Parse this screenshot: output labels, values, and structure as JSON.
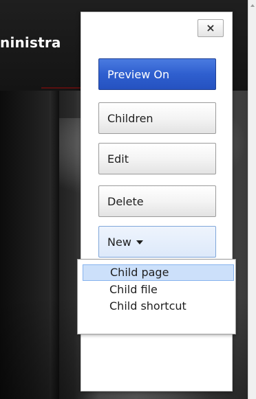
{
  "header": {
    "title_fragment": "ninistra"
  },
  "panel": {
    "close_label": "×",
    "buttons": {
      "preview": "Preview On",
      "children": "Children",
      "edit": "Edit",
      "delete": "Delete",
      "new": "New"
    }
  },
  "menu": {
    "items": [
      {
        "label": "Child page",
        "active": true
      },
      {
        "label": "Child file",
        "active": false
      },
      {
        "label": "Child shortcut",
        "active": false
      }
    ]
  },
  "icons": {
    "close": "close-icon",
    "new_dropdown": "chevron-down-icon"
  },
  "colors": {
    "primary_button": "#2f5fcf",
    "menu_highlight": "#cce0fa",
    "new_button": "#dde9fa"
  }
}
